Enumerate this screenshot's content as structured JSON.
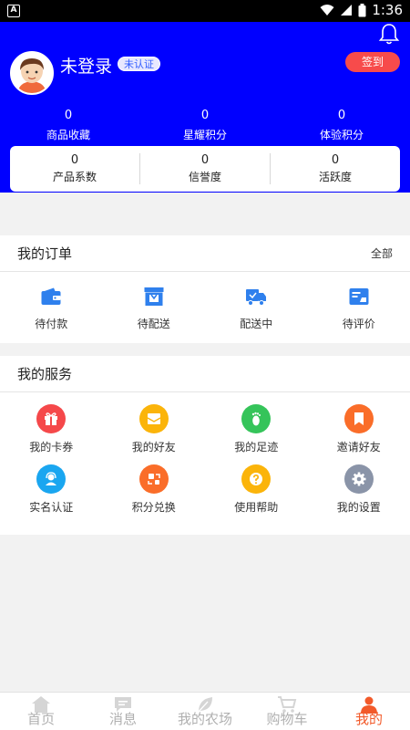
{
  "status_bar": {
    "time": "1:36",
    "notification_letter": "A"
  },
  "profile": {
    "username": "未登录",
    "badge": "未认证",
    "checkin_label": "签到"
  },
  "stats": [
    {
      "value": "0",
      "label": "商品收藏"
    },
    {
      "value": "0",
      "label": "星耀积分"
    },
    {
      "value": "0",
      "label": "体验积分"
    }
  ],
  "metrics": [
    {
      "value": "0",
      "label": "产品系数"
    },
    {
      "value": "0",
      "label": "信誉度"
    },
    {
      "value": "0",
      "label": "活跃度"
    }
  ],
  "orders": {
    "title": "我的订单",
    "more": "全部",
    "items": [
      {
        "label": "待付款",
        "icon": "wallet-icon"
      },
      {
        "label": "待配送",
        "icon": "store-icon"
      },
      {
        "label": "配送中",
        "icon": "truck-icon"
      },
      {
        "label": "待评价",
        "icon": "review-icon"
      }
    ]
  },
  "services": {
    "title": "我的服务",
    "items": [
      {
        "label": "我的卡券",
        "icon": "gift-icon",
        "color": "#f5484a"
      },
      {
        "label": "我的好友",
        "icon": "envelope-icon",
        "color": "#fbb40a"
      },
      {
        "label": "我的足迹",
        "icon": "footprint-icon",
        "color": "#35c45a"
      },
      {
        "label": "邀请好友",
        "icon": "bookmark-icon",
        "color": "#fa6d29"
      },
      {
        "label": "实名认证",
        "icon": "user-headset-icon",
        "color": "#1aa6f0"
      },
      {
        "label": "积分兑换",
        "icon": "exchange-icon",
        "color": "#fa6d29"
      },
      {
        "label": "使用帮助",
        "icon": "help-icon",
        "color": "#fbb40a"
      },
      {
        "label": "我的设置",
        "icon": "settings-icon",
        "color": "#8a94a8"
      }
    ]
  },
  "tabs": [
    {
      "label": "首页",
      "icon": "home-icon"
    },
    {
      "label": "消息",
      "icon": "message-icon"
    },
    {
      "label": "我的农场",
      "icon": "leaf-icon"
    },
    {
      "label": "购物车",
      "icon": "cart-icon"
    },
    {
      "label": "我的",
      "icon": "person-icon"
    }
  ],
  "colors": {
    "header_bg": "#0000ff",
    "accent": "#f25a2a",
    "checkin_bg": "#f74b4b",
    "order_icon": "#2f80ed"
  }
}
